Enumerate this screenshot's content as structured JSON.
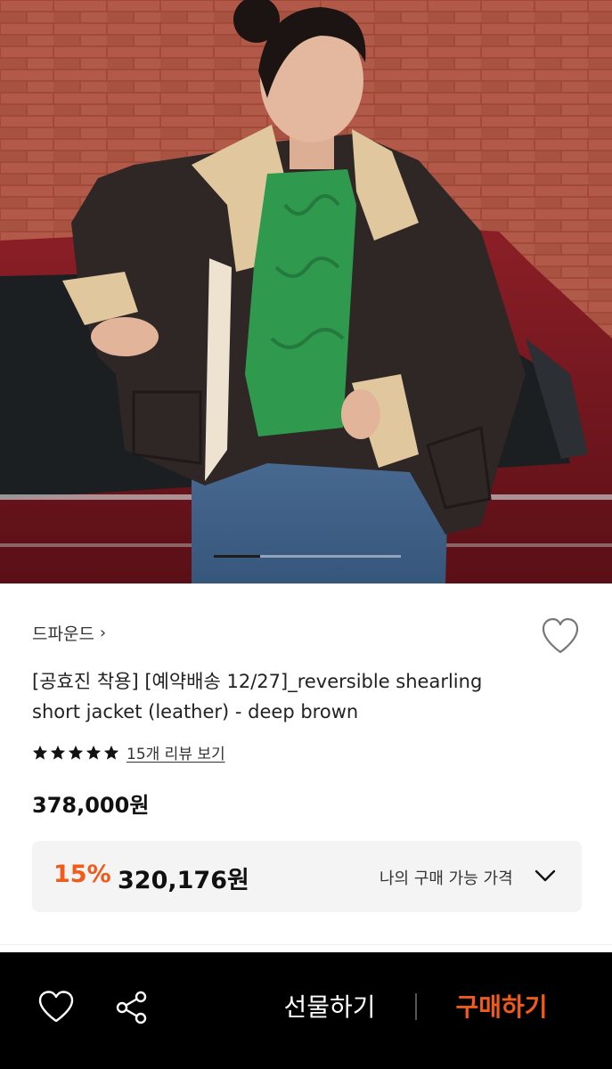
{
  "product": {
    "brand": "드파운드",
    "brand_chevron": "›",
    "title": "[공효진 착용] [예약배송 12/27]_reversible shearling short jacket (leather) - deep brown",
    "rating_stars": 5,
    "review_link": "15개 리뷰 보기",
    "price_original": "378,000원",
    "discount_rate": "15%",
    "discount_price": "320,176원",
    "my_price_label": "나의 구매 가능 가격"
  },
  "gallery": {
    "image_description_icon": "product-photo",
    "current_slide_fraction": 0.25
  },
  "bottom_bar": {
    "wish_icon": "heart-outline-icon",
    "share_icon": "share-icon",
    "gift_label": "선물하기",
    "buy_label": "구매하기"
  },
  "colors": {
    "accent": "#f05a1a",
    "bottom_bar_bg": "#000000",
    "price_box_bg": "#f4f4f4"
  }
}
